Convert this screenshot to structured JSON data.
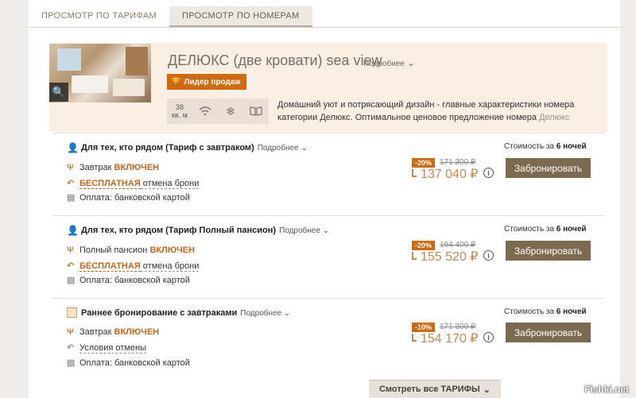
{
  "tabs": [
    "ПРОСМОТР ПО ТАРИФАМ",
    "ПРОСМОТР ПО НОМЕРАМ"
  ],
  "room": {
    "title": "ДЕЛЮКС (две кровати) sea view",
    "more": "Подробнее",
    "badge": "Лидер продаж",
    "area_value": "38",
    "area_unit": "кв. м",
    "desc_main": "Домашний уют и потрясающий дизайн - главные характеристики номера категории Делюкс. Оптимальное ценовое предложение номера",
    "desc_faded": "Делюкс"
  },
  "rates": [
    {
      "title": "Для тех, кто рядом (Тариф с завтраком)",
      "more": "Подробнее",
      "meal_prefix": "Завтрак ",
      "meal_status": "ВКЛЮЧЕН",
      "cancel_hl": "БЕСПЛАТНАЯ",
      "cancel_rest": " отмена брони",
      "payment": "Оплата: банковской картой",
      "discount": "-20%",
      "old_price": "171 300 ₽",
      "price": "137 040 ₽",
      "cost_prefix": "Стоимость за ",
      "cost_nights": "6 ночей",
      "book": "Забронировать"
    },
    {
      "title": "Для тех, кто рядом (Тариф Полный пансион)",
      "more": "Подробнее",
      "meal_prefix": "Полный пансион ",
      "meal_status": "ВКЛЮЧЕН",
      "cancel_hl": "БЕСПЛАТНАЯ",
      "cancel_rest": " отмена брони",
      "payment": "Оплата: банковской картой",
      "discount": "-20%",
      "old_price": "194 400 ₽",
      "price": "155 520 ₽",
      "cost_prefix": "Стоимость за ",
      "cost_nights": "6 ночей",
      "book": "Забронировать"
    },
    {
      "title": "Раннее бронирование с завтраками",
      "more": "Подробнее",
      "meal_prefix": "Завтрак ",
      "meal_status": "ВКЛЮЧЕН",
      "cancel_text": "Условия отмены",
      "payment": "Оплата: банковской картой",
      "discount": "-10%",
      "old_price": "171 300 ₽",
      "price": "154 170 ₽",
      "cost_prefix": "Стоимость за ",
      "cost_nights": "6 ночей",
      "book": "Забронировать"
    }
  ],
  "see_all": "Смотреть все ТАРИФЫ",
  "watermark": "Fishki.net",
  "colors": {
    "accent": "#d06a10",
    "button": "#7d6a4e",
    "price": "#c48a50"
  }
}
